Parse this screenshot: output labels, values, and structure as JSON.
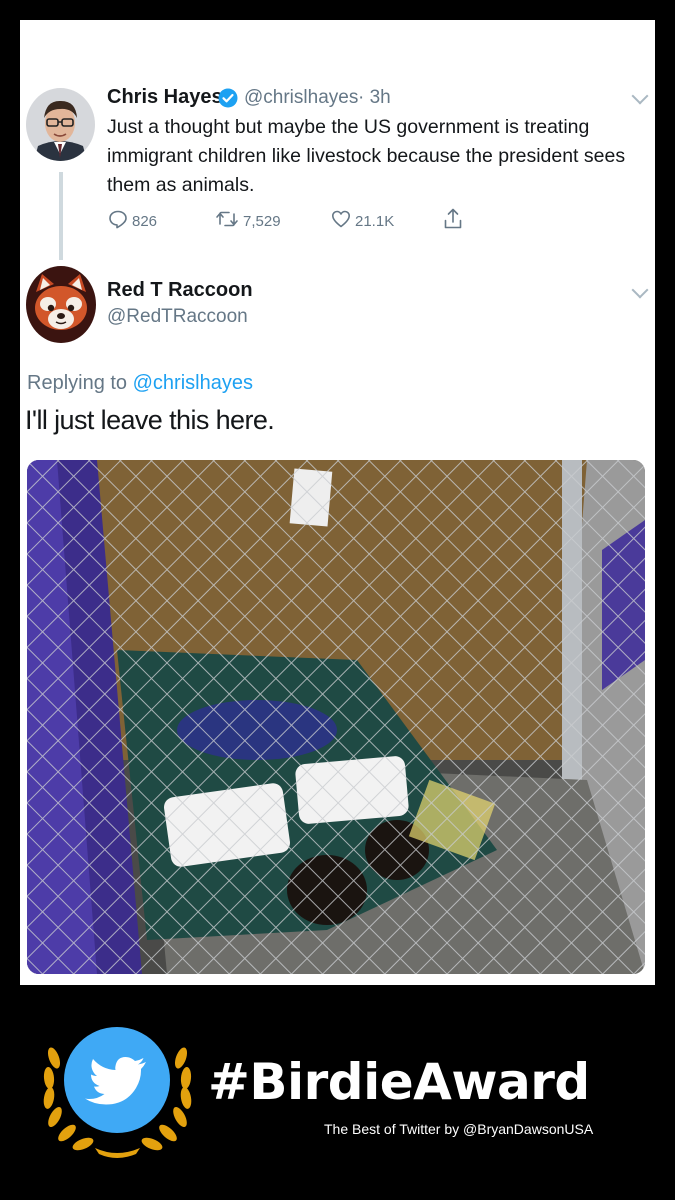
{
  "original_tweet": {
    "author_name": "Chris Hayes",
    "verified": true,
    "handle": "@chrislhayes",
    "time": "· 3h",
    "text": "Just a thought but maybe the US government is treating immigrant children like livestock because the president sees them as animals.",
    "replies": "826",
    "retweets": "7,529",
    "likes": "21.1K",
    "icons": [
      "reply-icon",
      "retweet-icon",
      "like-icon",
      "share-icon",
      "chevron-down-icon",
      "verified-icon"
    ]
  },
  "reply_tweet": {
    "author_name": "Red T Raccoon",
    "handle": "@RedTRaccoon",
    "replying_prefix": "Replying to",
    "replying_to": "@chrislhayes",
    "text": "I'll just leave this here.",
    "icons": [
      "chevron-down-icon"
    ]
  },
  "award": {
    "title": "#BirdieAward",
    "subtitle": "The Best of Twitter by @BryanDawsonUSA",
    "icons": [
      "twitter-bird-icon",
      "laurel-wreath-icon"
    ]
  },
  "colors": {
    "twitter_blue": "#1da1f2",
    "muted_text": "#657786",
    "laurel_gold": "#e3a10e",
    "background": "#000000"
  }
}
